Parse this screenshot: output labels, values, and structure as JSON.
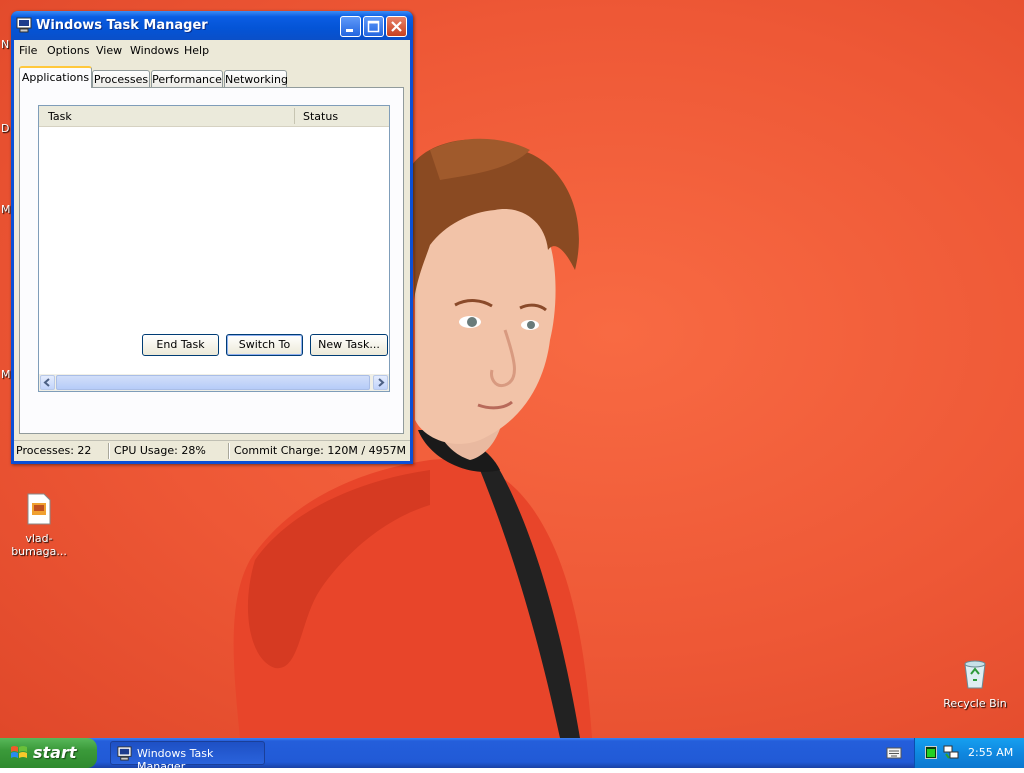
{
  "window": {
    "title": "Windows Task Manager",
    "menu": [
      "File",
      "Options",
      "View",
      "Windows",
      "Help"
    ],
    "tabs": [
      "Applications",
      "Processes",
      "Performance",
      "Networking"
    ],
    "active_tab": "Applications",
    "list": {
      "columns": [
        "Task",
        "Status"
      ],
      "rows": []
    },
    "buttons": {
      "end_task": "End Task",
      "switch_to": "Switch To",
      "new_task": "New Task..."
    },
    "status": {
      "processes": "Processes: 22",
      "cpu": "CPU Usage: 28%",
      "commit": "Commit Charge: 120M / 4957M"
    }
  },
  "desktop": {
    "icons": [
      {
        "label": "vlad-bumaga...",
        "icon": "image-file-icon"
      },
      {
        "label": "Recycle Bin",
        "icon": "recycle-bin-icon"
      }
    ],
    "edge_letters": [
      "N",
      "D",
      "M",
      "M"
    ]
  },
  "taskbar": {
    "start_label": "start",
    "task_item": "Windows Task Manager",
    "clock": "2:55 AM"
  }
}
